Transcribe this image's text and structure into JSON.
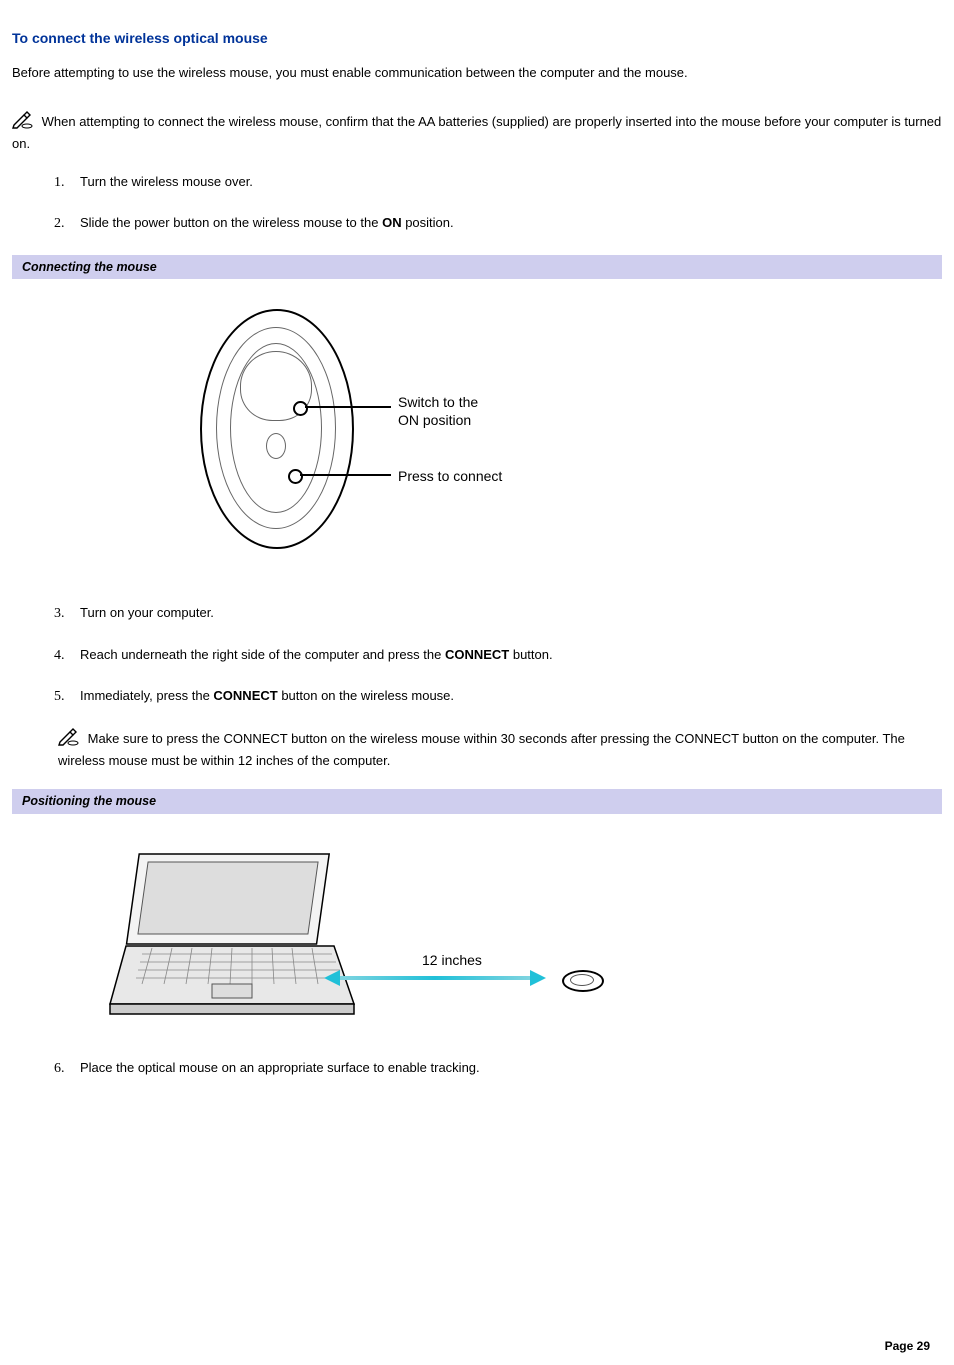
{
  "title": "To connect the wireless optical mouse",
  "intro": "Before attempting to use the wireless mouse, you must enable communication between the computer and the mouse.",
  "note1": "When attempting to connect the wireless mouse, confirm that the AA batteries (supplied) are properly inserted into the mouse before your computer is turned on.",
  "steps": {
    "s1": "Turn the wireless mouse over.",
    "s2_pre": "Slide the power button on the wireless mouse to the ",
    "s2_bold": "ON",
    "s2_post": " position.",
    "s3": "Turn on your computer.",
    "s4_pre": "Reach underneath the right side of the computer and press the ",
    "s4_bold": "CONNECT",
    "s4_post": " button.",
    "s5_pre": "Immediately, press the ",
    "s5_bold": "CONNECT",
    "s5_post": " button on the wireless mouse.",
    "s6": "Place the optical mouse on an appropriate surface to enable tracking."
  },
  "note2": "Make sure to press the CONNECT button on the wireless mouse within 30 seconds after pressing the CONNECT button on the computer. The wireless mouse must be within 12 inches of the computer.",
  "subheaders": {
    "h1": "Connecting the mouse",
    "h2": "Positioning the mouse"
  },
  "fig1": {
    "label_switch_l1": "Switch to the",
    "label_switch_l2": "ON position",
    "label_press": "Press to connect"
  },
  "fig2": {
    "distance": "12 inches"
  },
  "footer": "Page 29"
}
